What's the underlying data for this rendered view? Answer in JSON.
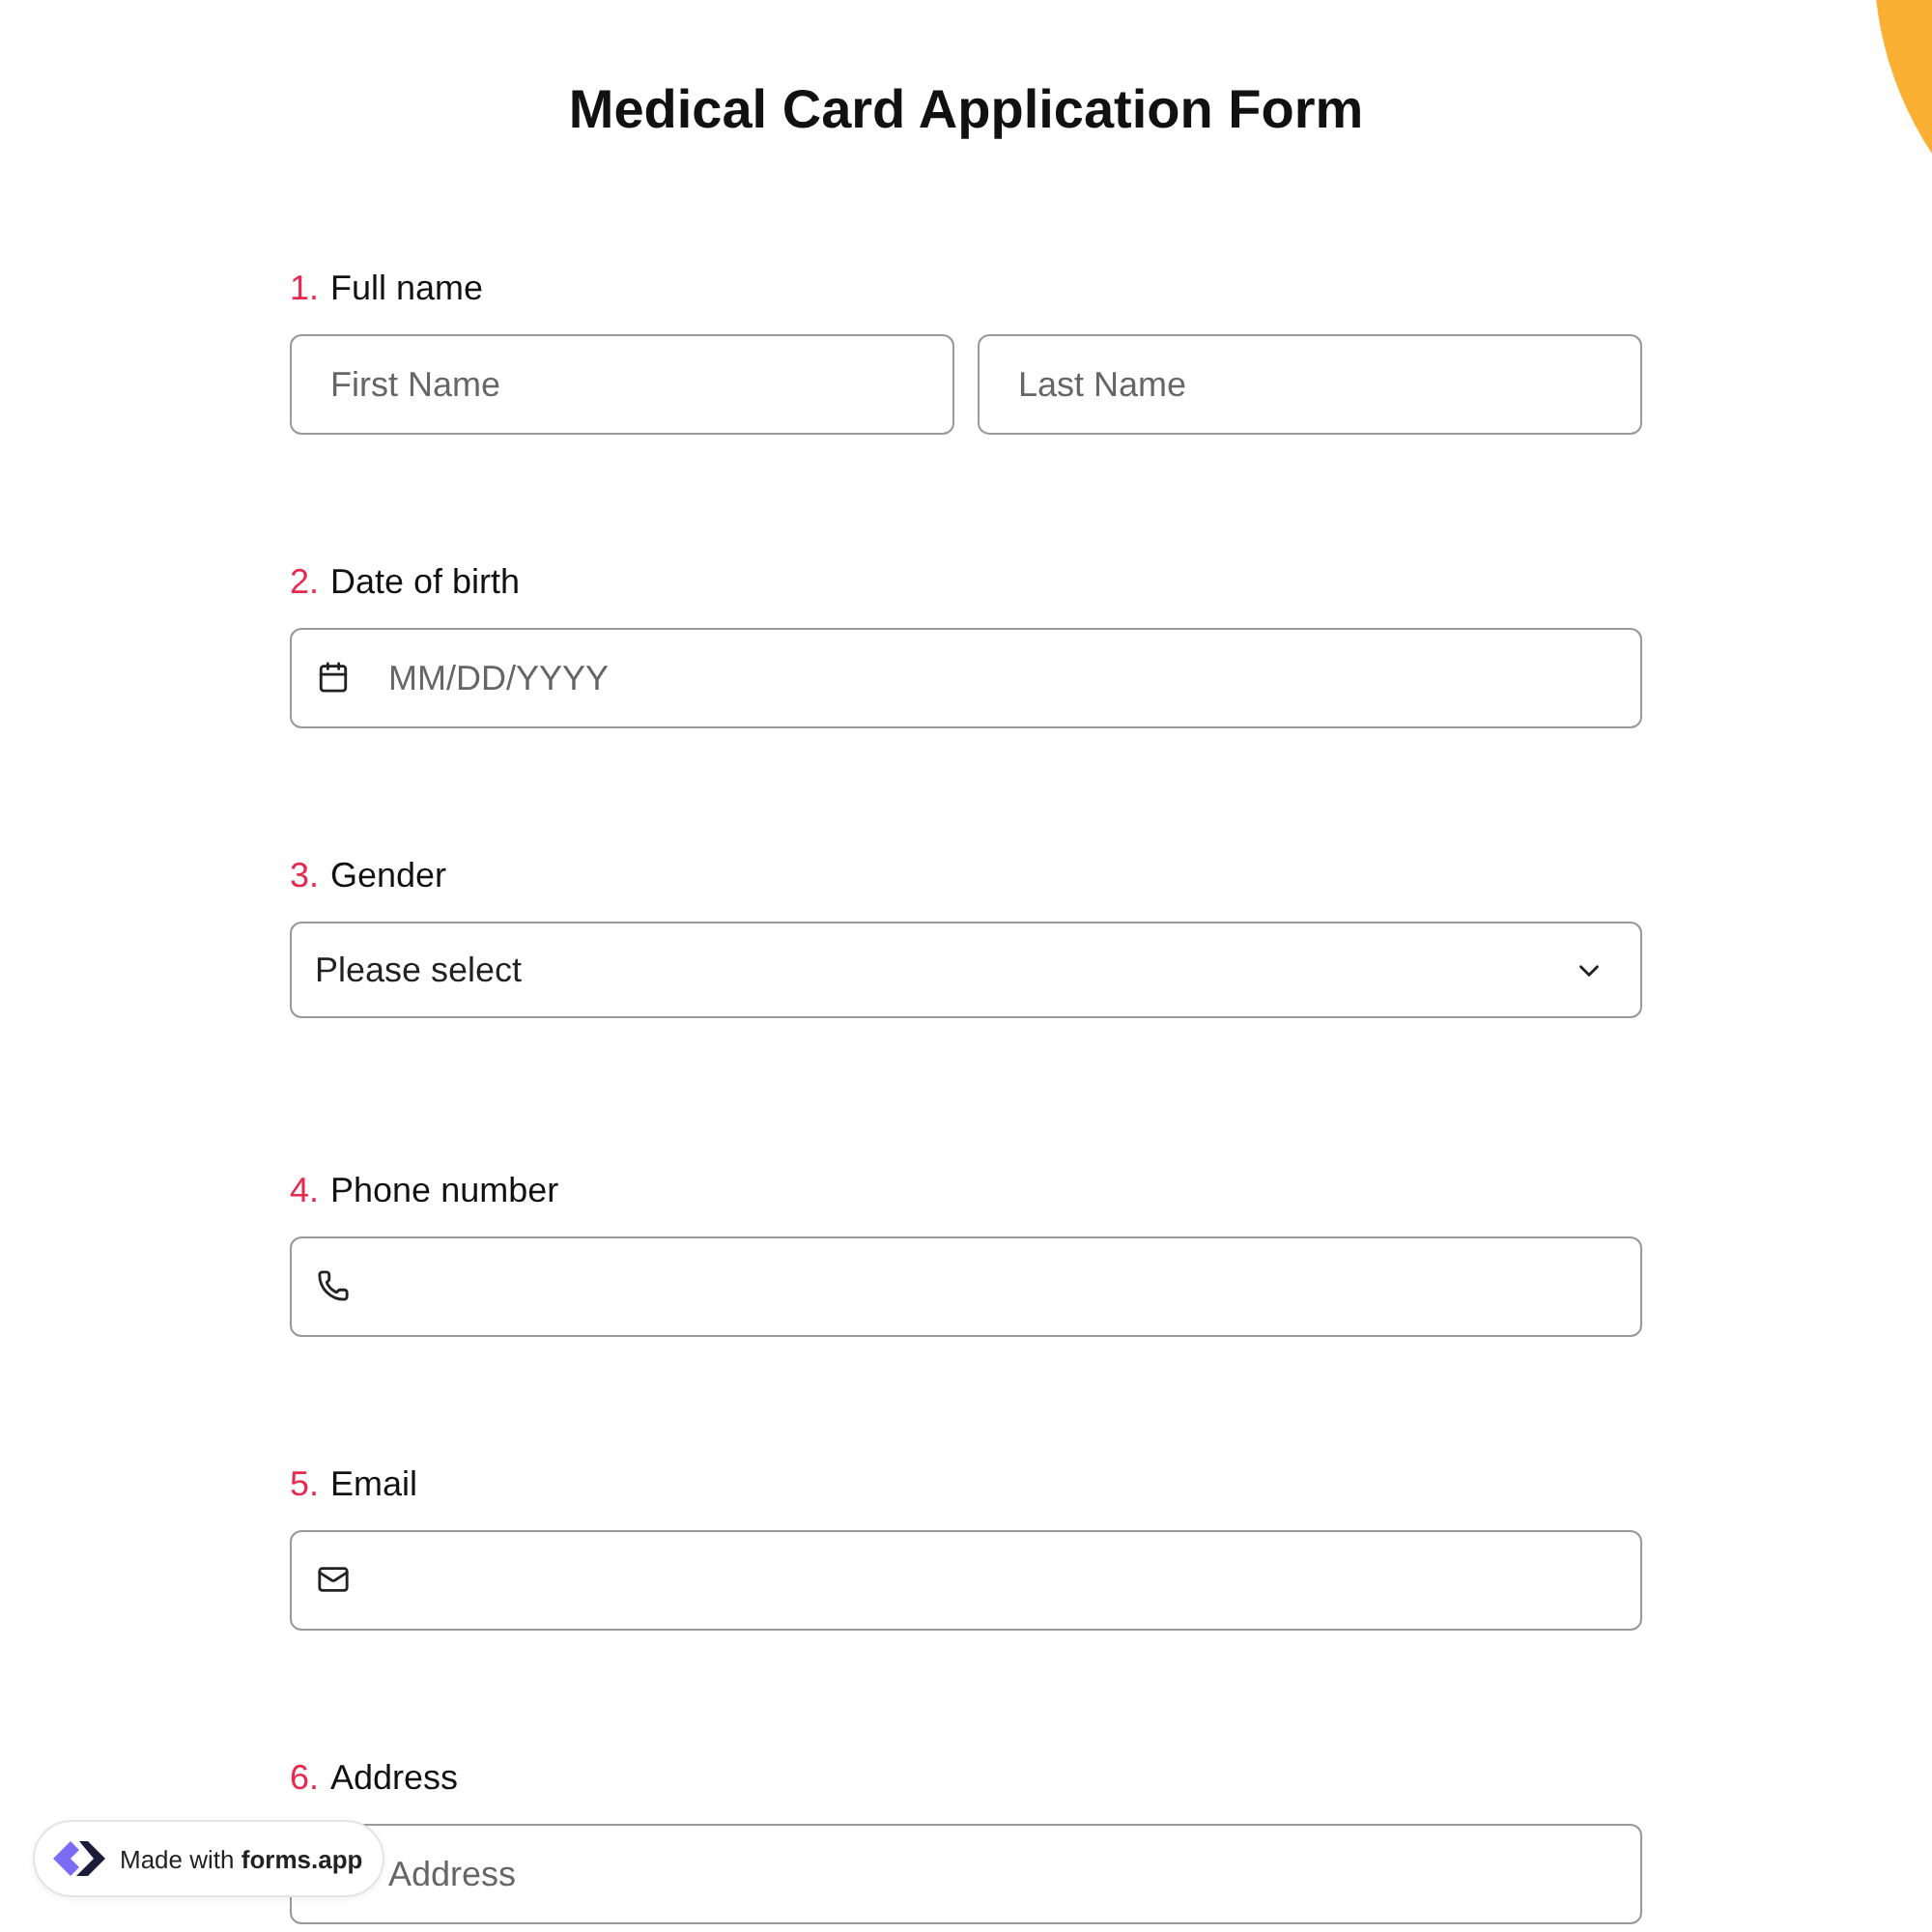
{
  "title": "Medical Card Application Form",
  "questions": [
    {
      "number": "1.",
      "label": "Full name",
      "kind": "name",
      "placeholders": [
        "First Name",
        "Last Name"
      ]
    },
    {
      "number": "2.",
      "label": "Date of birth",
      "kind": "date",
      "placeholder": "MM/DD/YYYY"
    },
    {
      "number": "3.",
      "label": "Gender",
      "kind": "select",
      "value": "Please select"
    },
    {
      "number": "4.",
      "label": "Phone number",
      "kind": "phone"
    },
    {
      "number": "5.",
      "label": "Email",
      "kind": "email"
    },
    {
      "number": "6.",
      "label": "Address",
      "kind": "address",
      "placeholder": "Address"
    }
  ],
  "badge": {
    "text": "Made with **forms.app**"
  }
}
